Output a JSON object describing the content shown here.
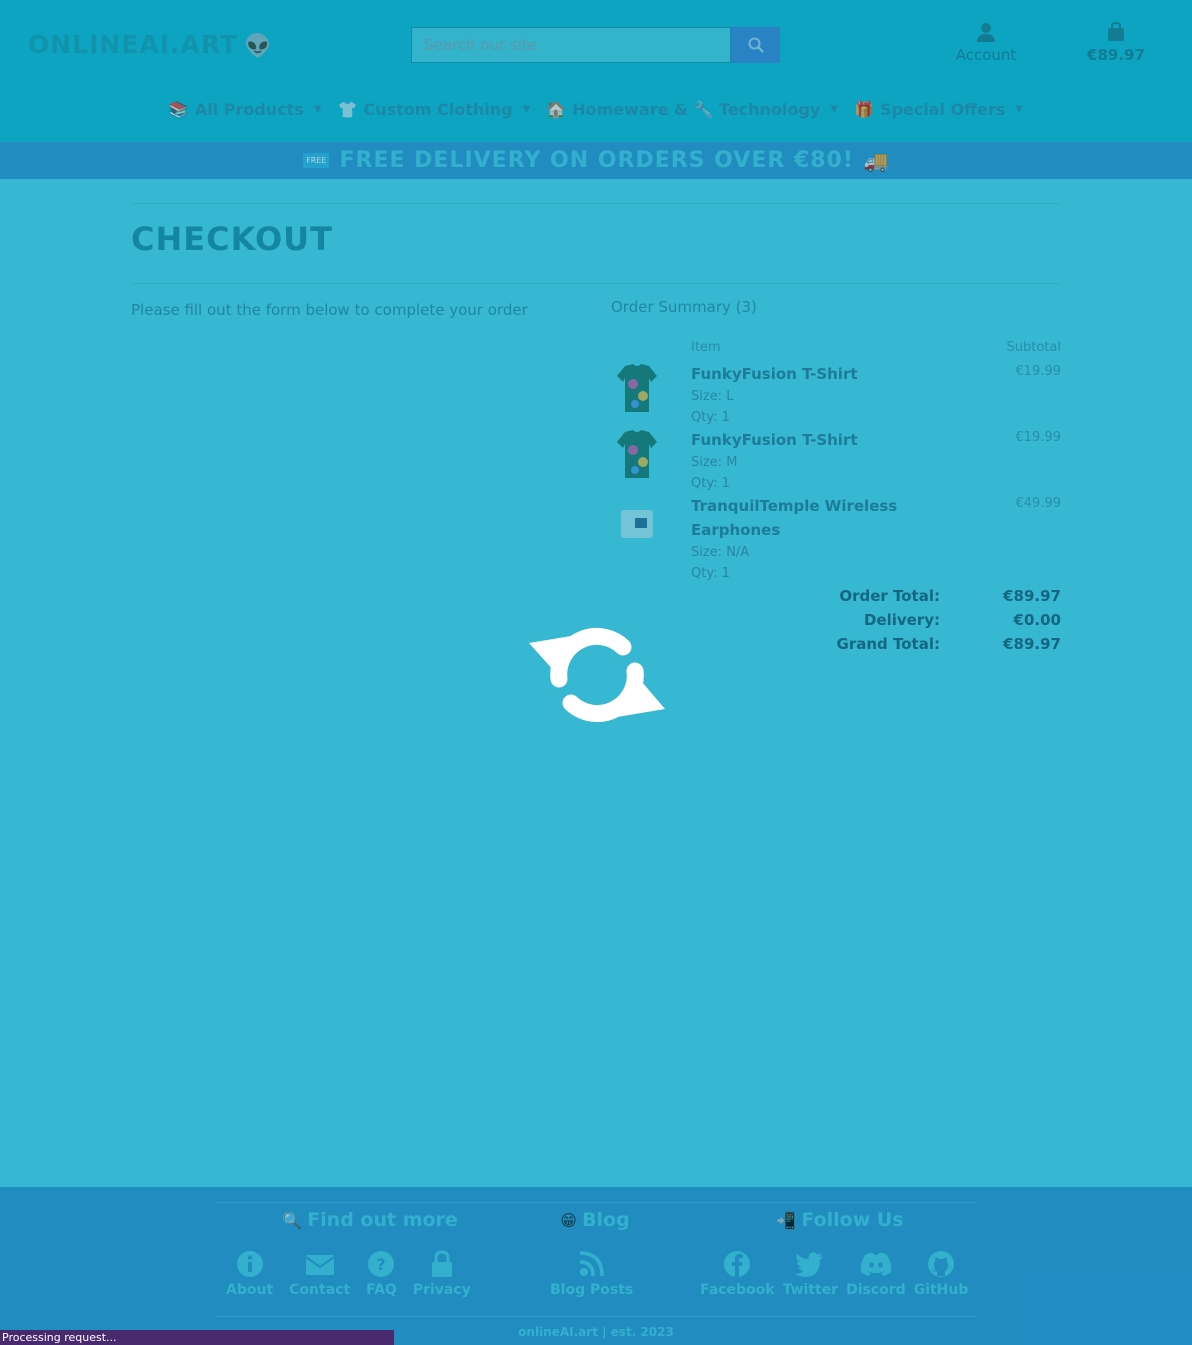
{
  "header": {
    "logo_text": "ONLINEAI.ART",
    "search": {
      "placeholder": "Search our site"
    },
    "account_label": "Account",
    "cart_total": "€89.97"
  },
  "nav": {
    "items": [
      {
        "label": "All Products",
        "icon": "folder-icon"
      },
      {
        "label": "Custom Clothing",
        "icon": "tshirt-icon"
      },
      {
        "label": "Homeware & 🔧 Technology",
        "icon": "house-icon"
      },
      {
        "label": "Special Offers",
        "icon": "gift-icon"
      }
    ]
  },
  "promo": {
    "badge": "FREE",
    "text": "FREE DELIVERY ON ORDERS OVER €80!"
  },
  "page": {
    "title": "CHECKOUT",
    "form_note": "Please fill out the form below to complete your order"
  },
  "summary": {
    "title": "Order Summary (3)",
    "col_item": "Item",
    "col_subtotal": "Subtotal",
    "items": [
      {
        "name": "FunkyFusion T-Shirt",
        "size": "Size: L",
        "qty": "Qty: 1",
        "price": "€19.99"
      },
      {
        "name": "FunkyFusion T-Shirt",
        "size": "Size: M",
        "qty": "Qty: 1",
        "price": "€19.99"
      },
      {
        "name": "TranquilTemple Wireless Earphones",
        "size": "Size: N/A",
        "qty": "Qty: 1",
        "price": "€49.99"
      }
    ],
    "order_total_label": "Order Total:",
    "order_total": "€89.97",
    "delivery_label": "Delivery:",
    "delivery": "€0.00",
    "grand_total_label": "Grand Total:",
    "grand_total": "€89.97"
  },
  "footer": {
    "find_out_more": {
      "title": "Find out more",
      "links": [
        "About",
        "Contact",
        "FAQ",
        "Privacy"
      ]
    },
    "blog": {
      "title": "Blog",
      "links": [
        "Blog Posts"
      ]
    },
    "follow": {
      "title": "Follow Us",
      "links": [
        "Facebook",
        "Twitter",
        "Discord",
        "GitHub"
      ]
    },
    "copyright": "onlineAI.art | est. 2023"
  },
  "overlay": {
    "status_text": "Processing request..."
  },
  "colors": {
    "header_bg": "#14b8d2",
    "promo_bg": "#3096d0",
    "overlay_tint": "#38b0c4",
    "status_bar": "#4a2a6e"
  }
}
